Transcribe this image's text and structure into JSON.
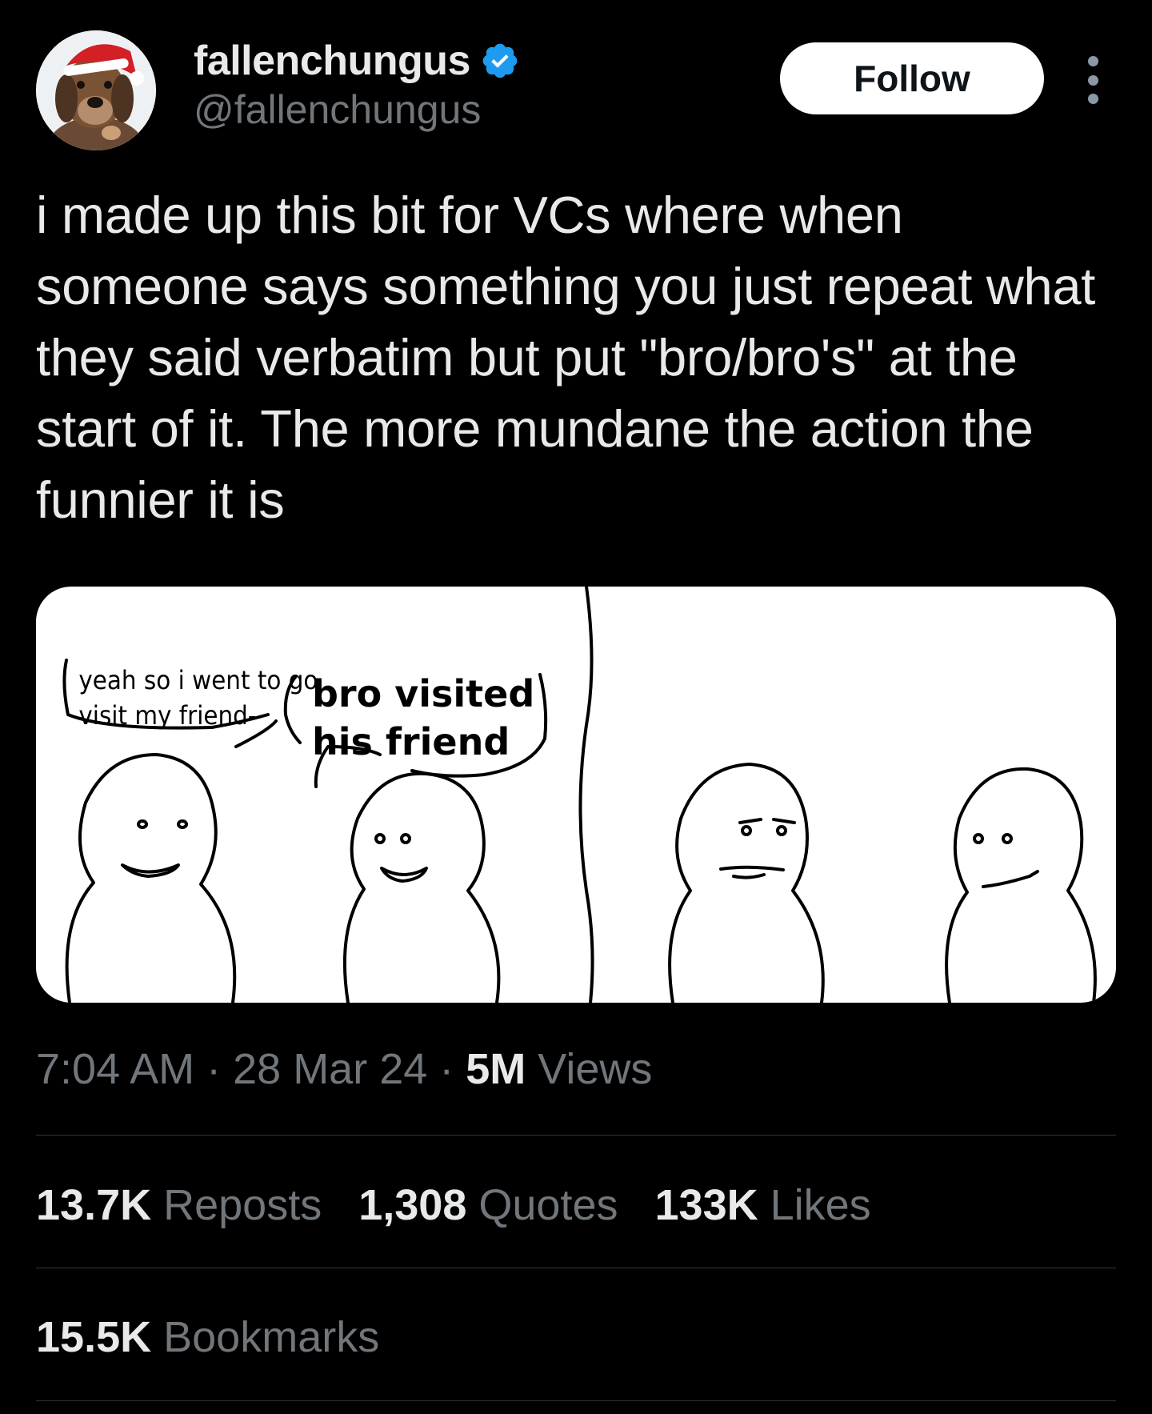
{
  "author": {
    "display_name": "fallenchungus",
    "handle": "@fallenchungus",
    "verified": true,
    "avatar_icon": "dog-santa-hat-avatar"
  },
  "actions": {
    "follow_label": "Follow",
    "more_icon": "more-vertical-icon"
  },
  "tweet": {
    "text": "i made up this bit for VCs where when someone says something you just repeat what they said verbatim but put \"bro/bro's\" at the start of it. The more mundane the action the funnier it is"
  },
  "media": {
    "comic": {
      "speech_left": [
        "yeah so i went to go",
        "visit my friend-"
      ],
      "speech_right": [
        "bro visited",
        "his friend"
      ]
    }
  },
  "meta": {
    "time": "7:04 AM",
    "sep1": " · ",
    "date": "28 Mar 24",
    "sep2": " · ",
    "views_count": "5M",
    "views_label": " Views"
  },
  "stats": {
    "reposts": {
      "count": "13.7K",
      "label": "Reposts"
    },
    "quotes": {
      "count": "1,308",
      "label": "Quotes"
    },
    "likes": {
      "count": "133K",
      "label": "Likes"
    },
    "bookmarks": {
      "count": "15.5K",
      "label": "Bookmarks"
    }
  },
  "colors": {
    "background": "#000000",
    "text_primary": "#e7e9ea",
    "text_secondary": "#71767b",
    "verified_blue": "#1d9bf0",
    "divider": "#2f3336"
  }
}
